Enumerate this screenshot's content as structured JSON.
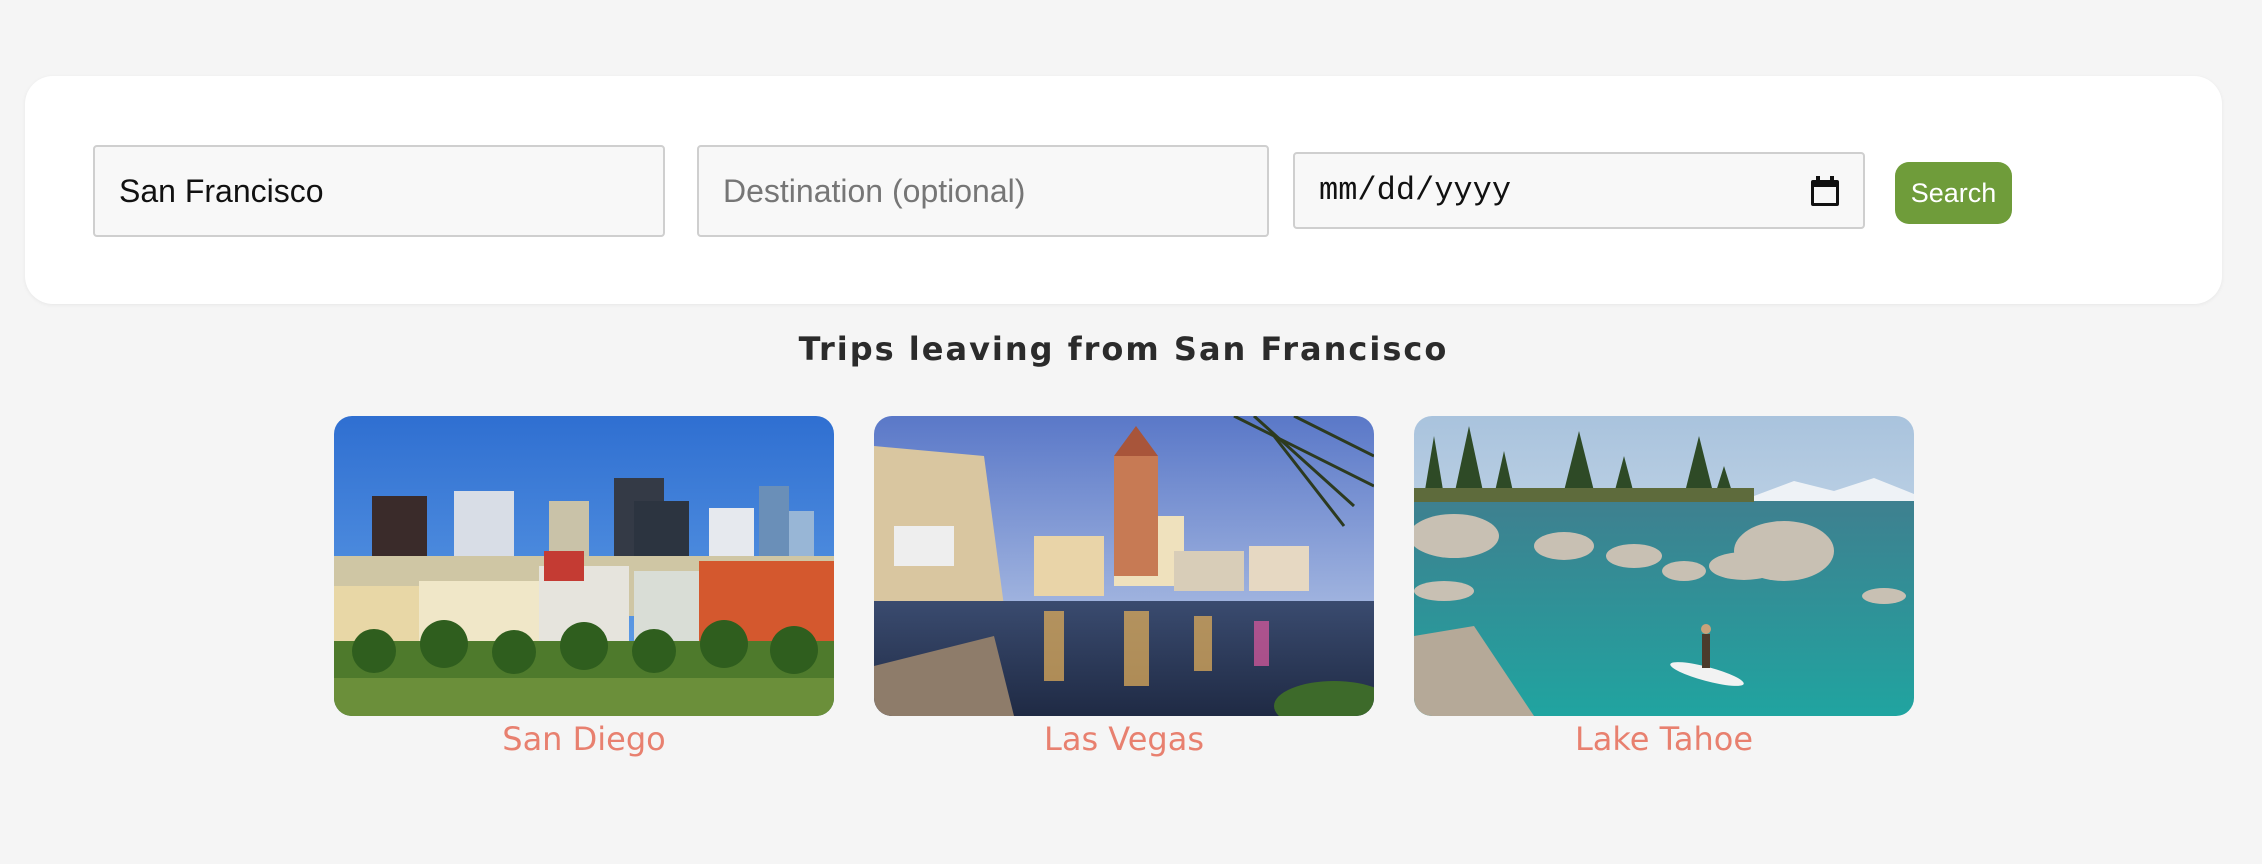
{
  "search": {
    "origin_value": "San Francisco",
    "destination_placeholder": "Destination (optional)",
    "date_placeholder": "mm/dd/yyyy",
    "button_label": "Search"
  },
  "heading": "Trips leaving from San Francisco",
  "trips": [
    {
      "label": "San Diego",
      "image": "city-skyline-photo"
    },
    {
      "label": "Las Vegas",
      "image": "strip-canal-photo"
    },
    {
      "label": "Lake Tahoe",
      "image": "lake-boulders-photo"
    }
  ],
  "colors": {
    "accent_button": "#6f9c3a",
    "trip_label": "#e8806f",
    "background": "#f5f5f5"
  }
}
